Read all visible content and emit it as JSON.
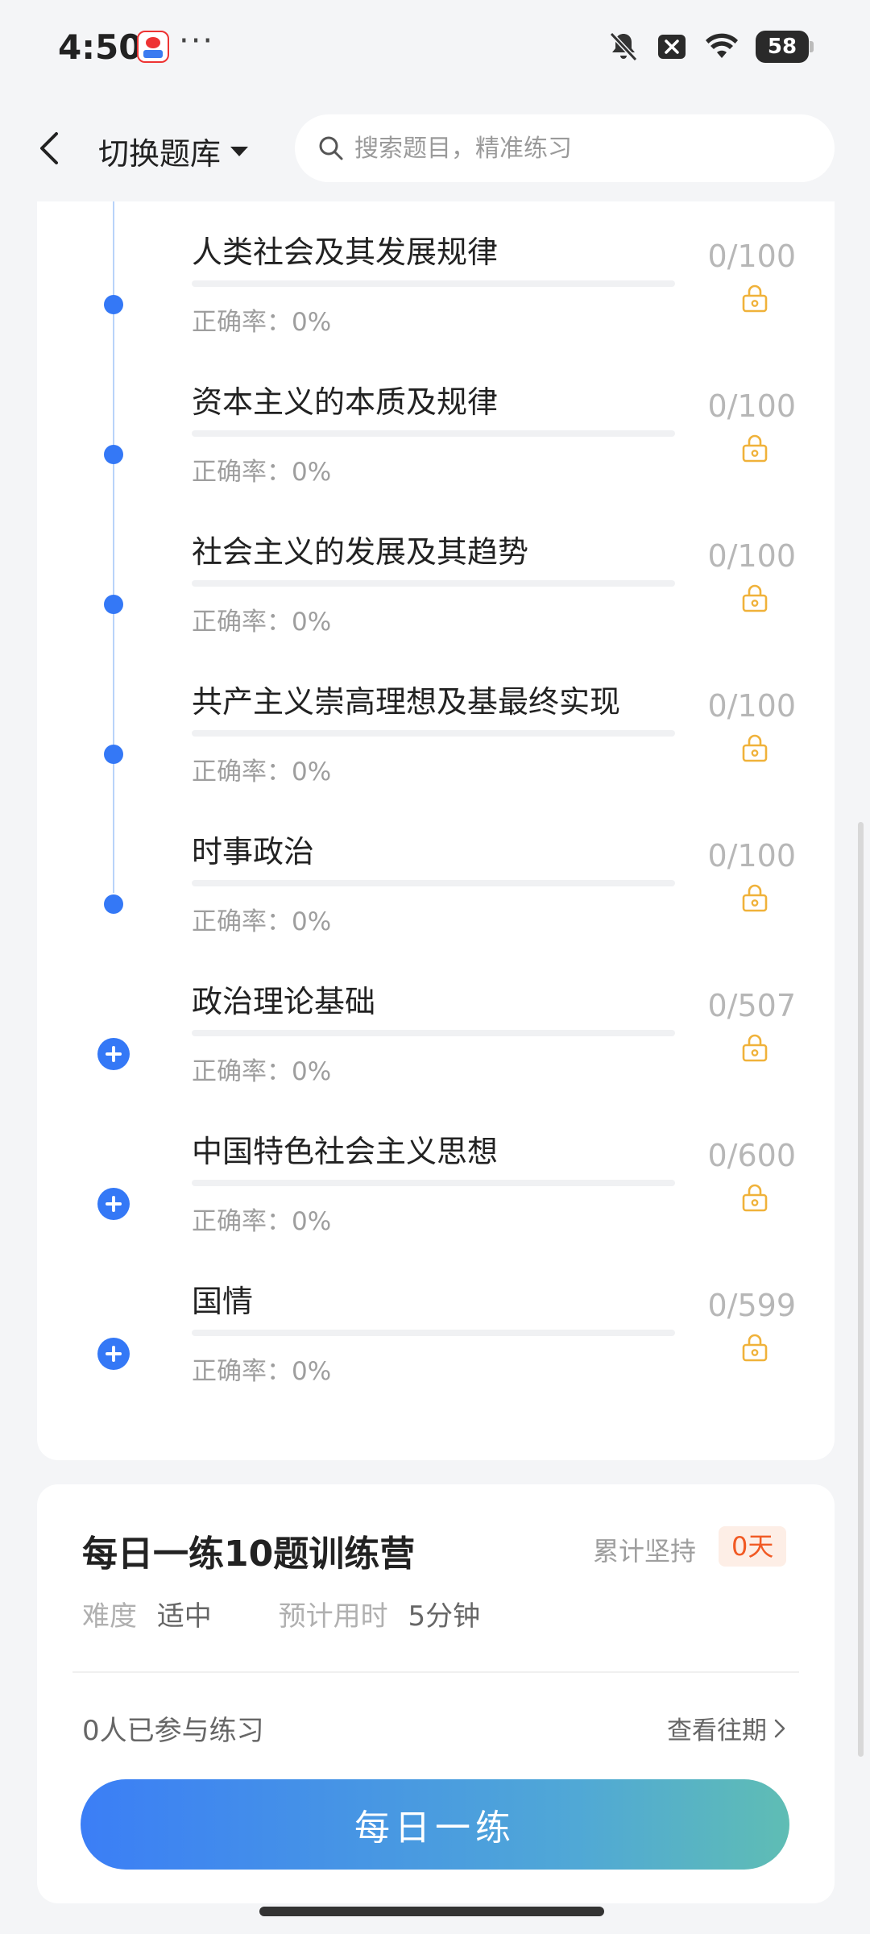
{
  "status_bar": {
    "time": "4:50",
    "more": "···",
    "battery": "58"
  },
  "header": {
    "bank_switch_label": "切换题库",
    "search_placeholder": "搜索题目，精准练习"
  },
  "chapters": [
    {
      "title": "人类社会及其发展规律",
      "accuracy": "正确率：0%",
      "count": "0/100",
      "progress": 0,
      "node": "dot"
    },
    {
      "title": "资本主义的本质及规律",
      "accuracy": "正确率：0%",
      "count": "0/100",
      "progress": 0,
      "node": "dot"
    },
    {
      "title": "社会主义的发展及其趋势",
      "accuracy": "正确率：0%",
      "count": "0/100",
      "progress": 0,
      "node": "dot"
    },
    {
      "title": "共产主义崇高理想及基最终实现",
      "accuracy": "正确率：0%",
      "count": "0/100",
      "progress": 0,
      "node": "dot"
    },
    {
      "title": "时事政治",
      "accuracy": "正确率：0%",
      "count": "0/100",
      "progress": 0,
      "node": "dot"
    },
    {
      "title": "政治理论基础",
      "accuracy": "正确率：0%",
      "count": "0/507",
      "progress": 0,
      "node": "expand"
    },
    {
      "title": "中国特色社会主义思想",
      "accuracy": "正确率：0%",
      "count": "0/600",
      "progress": 0,
      "node": "expand"
    },
    {
      "title": "国情",
      "accuracy": "正确率：0%",
      "count": "0/599",
      "progress": 0,
      "node": "expand"
    }
  ],
  "training_camp": {
    "title": "每日一练10题训练营",
    "streak_label": "累计坚持",
    "streak_value": "0天",
    "difficulty_label": "难度",
    "difficulty_value": "适中",
    "time_label": "预计用时",
    "time_value": "5分钟",
    "participants": "0人已参与练习",
    "history_link": "查看往期",
    "button_label": "每日一练"
  },
  "colors": {
    "accent": "#3478f6",
    "lock": "#f0b23a",
    "streak": "#f15a24"
  }
}
